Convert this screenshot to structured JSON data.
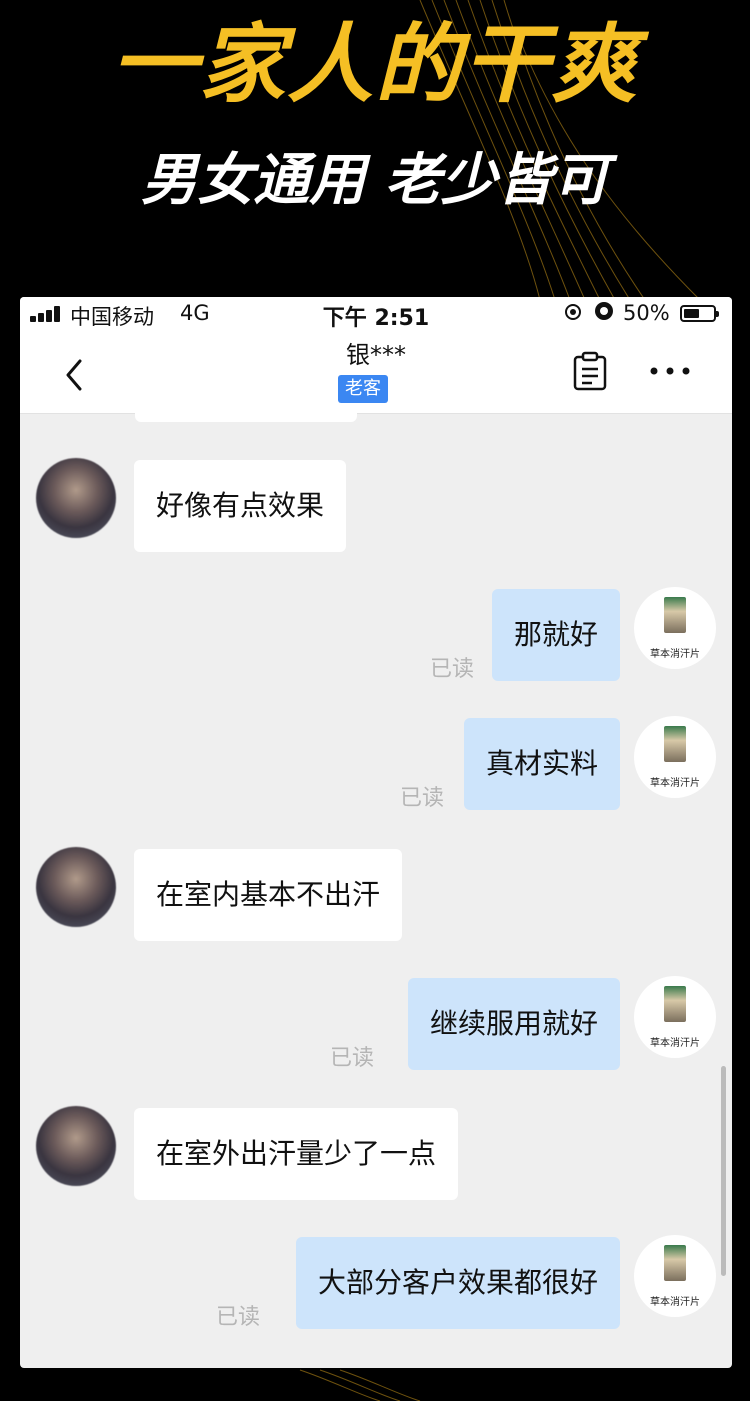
{
  "banner": {
    "headline": "一家人的干爽",
    "subheadline": "男女通用 老少皆可"
  },
  "status_bar": {
    "carrier": "中国移动",
    "network": "4G",
    "time": "下午 2:51",
    "battery": "50%"
  },
  "nav": {
    "contact_name": "银***",
    "badge": "老客"
  },
  "messages": [
    {
      "side": "left",
      "text": "好像有点效果"
    },
    {
      "side": "right",
      "text": "那就好",
      "status": "已读"
    },
    {
      "side": "right",
      "text": "真材实料",
      "status": "已读"
    },
    {
      "side": "left",
      "text": "在室内基本不出汗"
    },
    {
      "side": "right",
      "text": "继续服用就好",
      "status": "已读"
    },
    {
      "side": "left",
      "text": "在室外出汗量少了一点"
    },
    {
      "side": "right",
      "text": "大部分客户效果都很好",
      "status": "已读"
    }
  ],
  "self_avatar_label": "草本消汗片",
  "colors": {
    "headline": "#f5bf24",
    "badge": "#3b87f2",
    "outgoing_bubble": "#cde4fb",
    "incoming_bubble": "#ffffff"
  }
}
